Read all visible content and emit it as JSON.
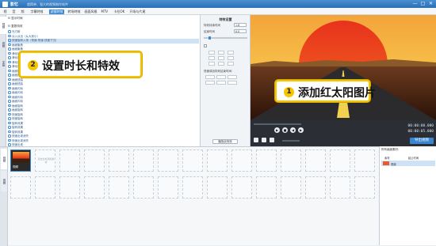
{
  "app": {
    "name": "影忆",
    "slogan": "超简单、强大的视频制作软件",
    "window_buttons": [
      "—",
      "□",
      "✕"
    ]
  },
  "menu": [
    "视",
    "音",
    "频",
    "字幕特效",
    "滤镜特效",
    "转场特效",
    "画面风格",
    "MTV",
    "卡拉OK",
    "开场与片尾"
  ],
  "menu_active_index": 4,
  "left_tabs": [
    "视频",
    "音频",
    "字幕"
  ],
  "effects": {
    "group1": "显示时间",
    "group2": "复数特效",
    "items": [
      "光刃射",
      "淡入淡出（从大到小）",
      "快速旋转入场（快速-快速-快速下沉）",
      "画面聚焦",
      "画面聚焦",
      "滑动效果",
      "滑动效果",
      "滑动效果",
      "滑动效果",
      "画面扭曲",
      "画面扭曲",
      "画面扭曲",
      "画面扭曲",
      "画面闪动",
      "画面闪动",
      "画面闪动",
      "画面闪动",
      "画面旋转",
      "画面旋转",
      "快速旋转",
      "快速旋转",
      "旋转效果",
      "旋转效果",
      "旋转效果",
      "快速出现消失",
      "快速出现消失",
      "快速出现",
      "快速出现"
    ],
    "selected_index": 2,
    "add_button": "添加到列表",
    "delete_button": "删除"
  },
  "settings": {
    "title": "特效设置",
    "label_start": "特效持续时间",
    "start_value": "1.8",
    "label_end": "结束时间",
    "end_value": "0.0",
    "label_options": "快速调出特效结束时间：",
    "preview_button": "播放此特效"
  },
  "preview": {
    "time_current": "00:00:00.000",
    "time_total": "00:00:05.000",
    "export_button": "导出视频"
  },
  "timeline": {
    "tabs": [
      "视频",
      "音频"
    ],
    "first_clip_label": "视频",
    "empty_hint": "双击此处添加素材"
  },
  "right_panel": {
    "header": "所有画面素材：",
    "col1": "素材",
    "col2": "起止时间",
    "row_label": "视频"
  },
  "callouts": {
    "one": {
      "num": "1",
      "text": "添加红太阳图片"
    },
    "two": {
      "num": "2",
      "text": "设置时长和特效"
    }
  }
}
